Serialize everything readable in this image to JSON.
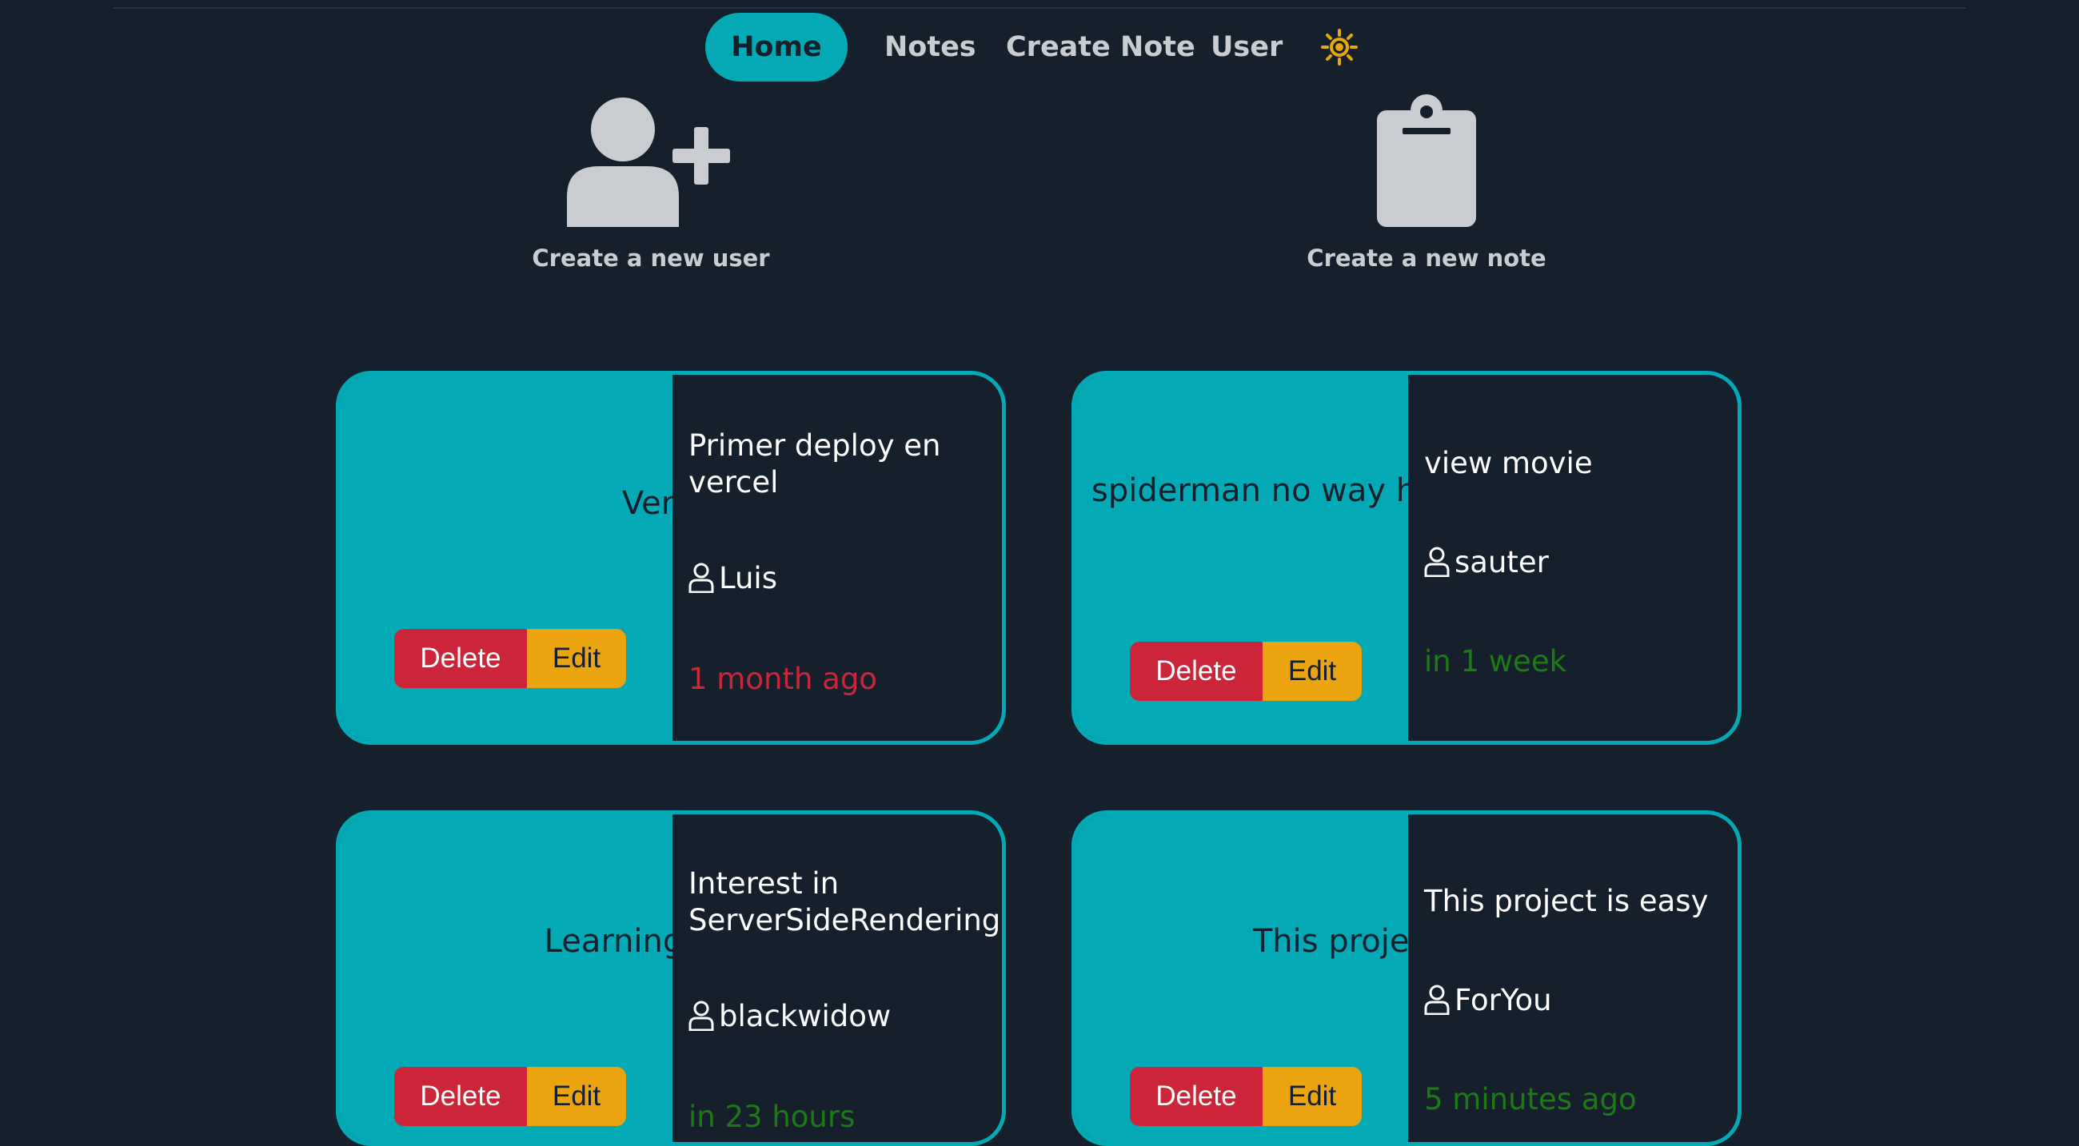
{
  "nav": {
    "items": [
      {
        "label": "Home",
        "active": true
      },
      {
        "label": "Notes",
        "active": false
      },
      {
        "label": "Create Note",
        "active": false
      },
      {
        "label": "User",
        "active": false
      }
    ],
    "theme_toggle_icon": "sun-icon"
  },
  "quick_actions": {
    "create_user": {
      "label": "Create a new user",
      "icon": "user-plus-icon"
    },
    "create_note": {
      "label": "Create a new note",
      "icon": "clipboard-icon"
    }
  },
  "colors": {
    "background": "#16202c",
    "accent": "#03aab5",
    "delete": "#cc2539",
    "edit": "#eba40f",
    "date_past": "#cc2539",
    "date_future": "#1c7a15",
    "sun": "#e6a70b"
  },
  "notes": [
    {
      "title": "Vercel",
      "content": "Primer deploy en vercel",
      "author": "Luis",
      "date": "1 month ago",
      "date_state": "past",
      "delete_label": "Delete",
      "edit_label": "Edit"
    },
    {
      "title": "spiderman no way home",
      "content": "view movie",
      "author": "sauter",
      "date": "in 1 week",
      "date_state": "future",
      "delete_label": "Delete",
      "edit_label": "Edit"
    },
    {
      "title": "Learning NextJS",
      "content": "Interest in ServerSideRendering",
      "author": "blackwidow",
      "date": "in 23 hours",
      "date_state": "future",
      "delete_label": "Delete",
      "edit_label": "Edit"
    },
    {
      "title": "This project is easy",
      "content": "This project is easy",
      "author": "ForYou",
      "date": "5 minutes ago",
      "date_state": "future",
      "delete_label": "Delete",
      "edit_label": "Edit"
    }
  ]
}
